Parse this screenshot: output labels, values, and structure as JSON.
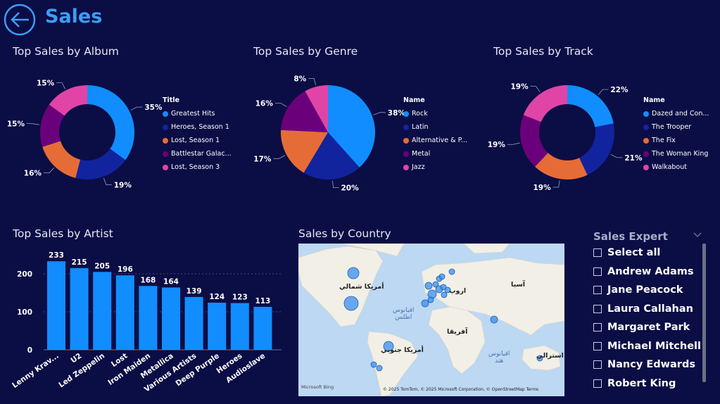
{
  "header": {
    "title": "Sales",
    "back_icon": "back-arrow-icon"
  },
  "colors": {
    "background": "#0b0d45",
    "accent": "#3d9df5",
    "series": [
      "#118dff",
      "#12239e",
      "#e66c37",
      "#6b007b",
      "#e044a7"
    ]
  },
  "album": {
    "title": "Top Sales by Album",
    "legend_title": "Title",
    "chart_data": {
      "type": "pie",
      "donut": true,
      "labels": [
        "Greatest Hits",
        "Heroes, Season 1",
        "Lost, Season 1",
        "Battlestar Galac...",
        "Lost, Season 3"
      ],
      "values": [
        35,
        19,
        16,
        15,
        15
      ],
      "pct_labels": [
        "35%",
        "19%",
        "16%",
        "15%",
        "15%"
      ]
    }
  },
  "genre": {
    "title": "Top Sales by Genre",
    "legend_title": "Name",
    "chart_data": {
      "type": "pie",
      "donut": false,
      "labels": [
        "Rock",
        "Latin",
        "Alternative & P...",
        "Metal",
        "Jazz"
      ],
      "values": [
        38,
        20,
        17,
        16,
        8
      ],
      "pct_labels": [
        "38%",
        "20%",
        "17%",
        "16%",
        "8%"
      ]
    }
  },
  "track": {
    "title": "Top Sales by Track",
    "legend_title": "Name",
    "chart_data": {
      "type": "pie",
      "donut": true,
      "labels": [
        "Dazed and Con...",
        "The Trooper",
        "The Fix",
        "The Woman King",
        "Walkabout"
      ],
      "values": [
        22,
        21,
        19,
        19,
        19
      ],
      "pct_labels": [
        "22%",
        "21%",
        "19%",
        "19%",
        "19%"
      ]
    }
  },
  "artist": {
    "title": "Top Sales by Artist",
    "chart_data": {
      "type": "bar",
      "categories": [
        "Lenny Krav...",
        "U2",
        "Led Zeppelin",
        "Lost",
        "Iron Maiden",
        "Metallica",
        "Various Artists",
        "Deep Purple",
        "Heroes",
        "Audioslave"
      ],
      "values": [
        233,
        215,
        205,
        196,
        168,
        164,
        139,
        124,
        123,
        113
      ],
      "yticks": [
        "0",
        "100",
        "200"
      ],
      "ylim": [
        0,
        250
      ]
    }
  },
  "country": {
    "title": "Sales by Country",
    "labels": {
      "north_america": "أمريكا شمالي",
      "south_america": "أمريكا جنوبي",
      "europe": "اروپ",
      "asia": "آسيا",
      "africa": "آفريقا",
      "oceania": "استرالي",
      "atlantic": "اقيانوس\nاطلس",
      "indian": "اقيانوس\nهند"
    },
    "attribution": "© 2025 TomTom, © 2025 Microsoft Corporation, © OpenStreetMap Terms",
    "bing": "Microsoft Bing"
  },
  "slicer": {
    "title": "Sales Expert",
    "items": [
      "Select all",
      "Andrew Adams",
      "Jane Peacock",
      "Laura Callahan",
      "Margaret Park",
      "Michael Mitchell",
      "Nancy Edwards",
      "Robert King"
    ]
  }
}
